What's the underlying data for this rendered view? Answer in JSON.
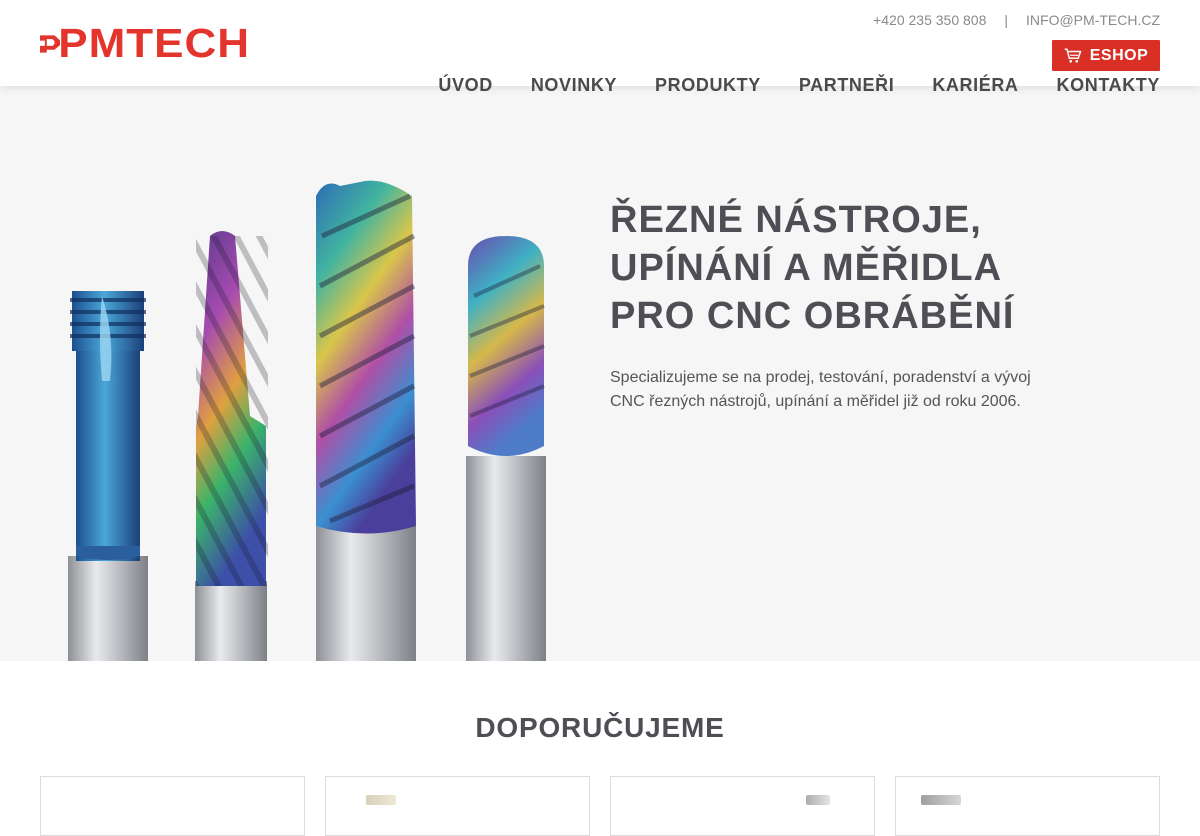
{
  "header": {
    "logo_text": "PMTECH",
    "phone": "+420 235 350 808",
    "separator": "|",
    "email": "INFO@PM-TECH.CZ",
    "eshop_label": "ESHOP",
    "nav": [
      {
        "label": "ÚVOD"
      },
      {
        "label": "NOVINKY"
      },
      {
        "label": "PRODUKTY"
      },
      {
        "label": "PARTNEŘI"
      },
      {
        "label": "KARIÉRA"
      },
      {
        "label": "KONTAKTY"
      }
    ]
  },
  "hero": {
    "title_lines": [
      "ŘEZNÉ NÁSTROJE,",
      "UPÍNÁNÍ A MĚŘIDLA",
      "PRO CNC OBRÁBĚNÍ"
    ],
    "subtitle": "Specializujeme se na prodej, testování, poradenství a vývoj CNC řezných nástrojů, upínání a měřidel již od roku 2006."
  },
  "recommend": {
    "title": "DOPORUČUJEME",
    "cards": [
      {
        "id": 1
      },
      {
        "id": 2
      },
      {
        "id": 3
      },
      {
        "id": 4
      }
    ]
  },
  "colors": {
    "brand_red": "#e3352b",
    "eshop_red": "#d92f25",
    "heading": "#4e4e55",
    "hero_bg": "#f6f6f6"
  },
  "icons": {
    "cart": "cart-icon",
    "logo_mark": "pm-logo-mark-icon"
  }
}
